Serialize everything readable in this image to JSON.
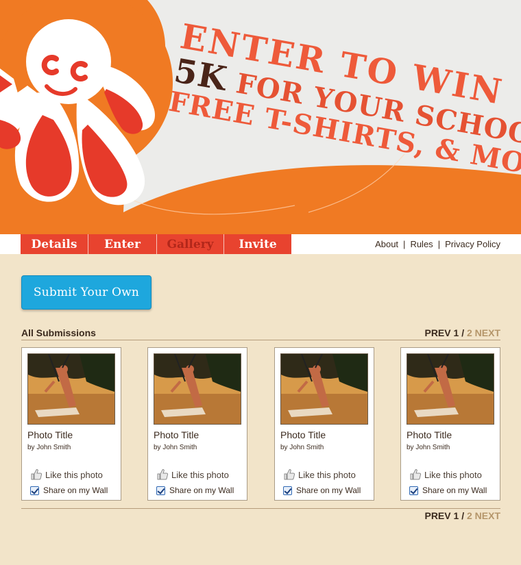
{
  "banner": {
    "headline_line1": "ENTER TO WIN",
    "headline_5k": "5K",
    "headline_line2_rest": " FOR YOUR SCHOOL,",
    "headline_line3": "FREE T-SHIRTS, & MORE",
    "mascot": "octopus-mascot-logo"
  },
  "nav": {
    "tabs": [
      {
        "label": "Details",
        "active": false
      },
      {
        "label": "Enter",
        "active": false
      },
      {
        "label": "Gallery",
        "active": true
      },
      {
        "label": "Invite",
        "active": false
      }
    ],
    "links": [
      "About",
      "Rules",
      "Privacy Policy"
    ],
    "separator": "|"
  },
  "main": {
    "submit_label": "Submit Your Own",
    "section_title": "All Submissions",
    "pager": {
      "prev": "PREV",
      "current": "1",
      "slash": "/",
      "next_page": "2",
      "next": "NEXT"
    },
    "cards": [
      {
        "title": "Photo Title",
        "author": "by John Smith",
        "like": "Like this photo",
        "share": "Share on my Wall"
      },
      {
        "title": "Photo Title",
        "author": "by John Smith",
        "like": "Like this photo",
        "share": "Share on my Wall"
      },
      {
        "title": "Photo Title",
        "author": "by John Smith",
        "like": "Like this photo",
        "share": "Share on my Wall"
      },
      {
        "title": "Photo Title",
        "author": "by John Smith",
        "like": "Like this photo",
        "share": "Share on my Wall"
      }
    ]
  },
  "colors": {
    "page_bg": "#f2e4c9",
    "tab_red": "#e8432f",
    "banner_orange": "#f07a23",
    "button_blue": "#1ea7dd",
    "text_brown": "#3b2a1e",
    "muted_tan": "#b5966a"
  }
}
